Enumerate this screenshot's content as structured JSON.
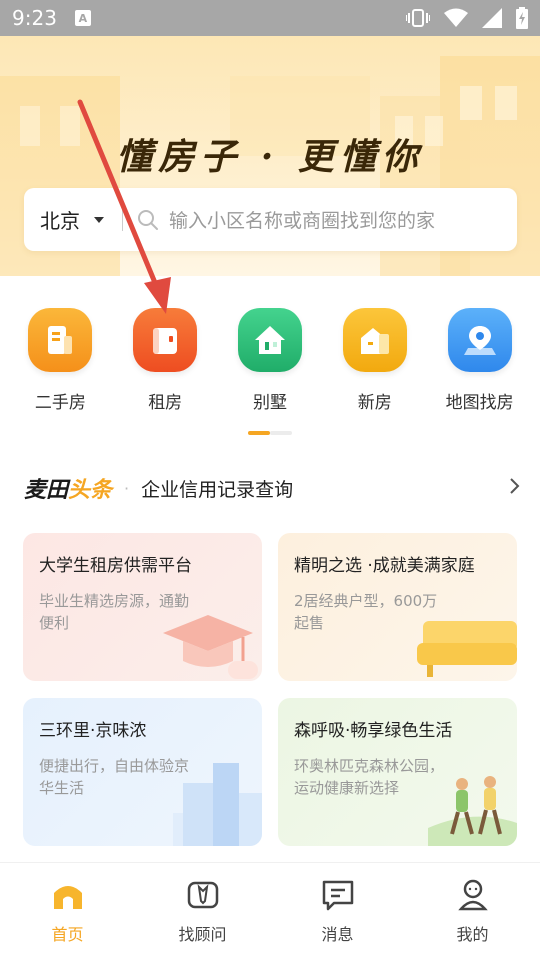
{
  "status_bar": {
    "time": "9:23",
    "notification_letter": "A",
    "icons": [
      "vibrate-icon",
      "wifi-icon",
      "signal-icon",
      "battery-icon"
    ]
  },
  "hero": {
    "slogan": "懂房子 · 更懂你"
  },
  "search": {
    "city": "北京",
    "placeholder": "输入小区名称或商圈找到您的家"
  },
  "categories": [
    {
      "label": "二手房",
      "icon": "second-hand-house-icon",
      "color": "#f7a21b"
    },
    {
      "label": "租房",
      "icon": "rent-icon",
      "color": "#f2612b"
    },
    {
      "label": "别墅",
      "icon": "villa-icon",
      "color": "#2dbf7a"
    },
    {
      "label": "新房",
      "icon": "new-house-icon",
      "color": "#f5b11c"
    },
    {
      "label": "地图找房",
      "icon": "map-pin-icon",
      "color": "#3d9bf2"
    }
  ],
  "headline": {
    "brand_part1": "麦田",
    "brand_part2": "头条",
    "separator": "·",
    "text": "企业信用记录查询"
  },
  "cards": [
    {
      "title": "大学生租房供需平台",
      "desc": "毕业生精选房源，通勤便利"
    },
    {
      "title": "精明之选 ·成就美满家庭",
      "desc": "2居经典户型，600万起售"
    },
    {
      "title": "三环里·京味浓",
      "desc": "便捷出行，自由体验京华生活"
    },
    {
      "title": "森呼吸·畅享绿色生活",
      "desc": "环奥林匹克森林公园，运动健康新选择"
    }
  ],
  "bottom_nav": [
    {
      "label": "首页",
      "icon": "home-icon",
      "active": true
    },
    {
      "label": "找顾问",
      "icon": "advisor-icon",
      "active": false
    },
    {
      "label": "消息",
      "icon": "message-icon",
      "active": false
    },
    {
      "label": "我的",
      "icon": "profile-icon",
      "active": false
    }
  ],
  "colors": {
    "accent": "#f5a623",
    "annotation_arrow": "#e04a3f"
  }
}
